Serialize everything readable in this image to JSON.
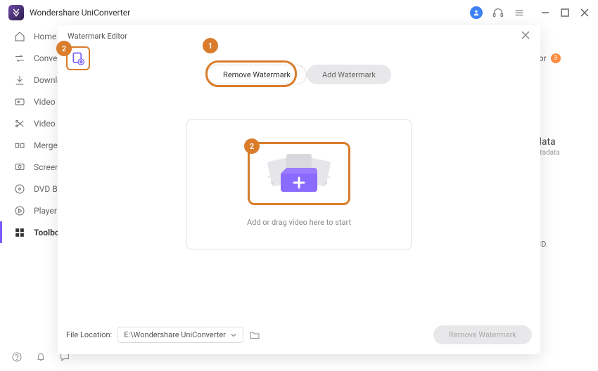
{
  "app": {
    "title": "Wondershare UniConverter"
  },
  "sidebar": {
    "items": [
      {
        "label": "Home"
      },
      {
        "label": "Converter"
      },
      {
        "label": "Downloader"
      },
      {
        "label": "Video Compressor"
      },
      {
        "label": "Video Editor"
      },
      {
        "label": "Merger"
      },
      {
        "label": "Screen Recorder"
      },
      {
        "label": "DVD Burner"
      },
      {
        "label": "Player"
      },
      {
        "label": "Toolbox"
      }
    ]
  },
  "right_peek": {
    "tor_label": "tor",
    "tor_badge": "3",
    "data_title": "data",
    "data_sub": "etadata",
    "cd_text": "CD."
  },
  "modal": {
    "title": "Watermark Editor",
    "tabs": {
      "remove": "Remove Watermark",
      "add": "Add Watermark"
    },
    "drop_text": "Add or drag video here to start",
    "file_label": "File Location:",
    "file_value": "E:\\Wondershare UniConverter",
    "remove_btn": "Remove Watermark"
  },
  "callouts": {
    "one": "1",
    "two_a": "2",
    "two_b": "2"
  }
}
